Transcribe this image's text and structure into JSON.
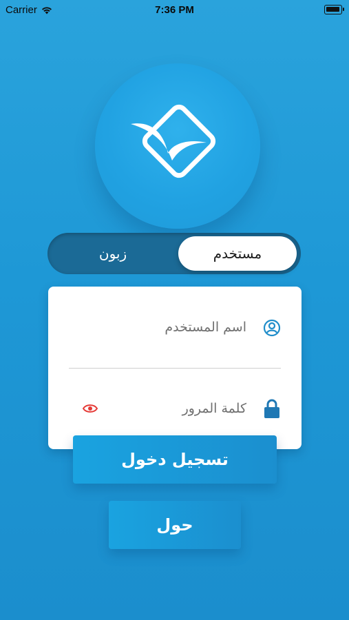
{
  "status_bar": {
    "carrier": "Carrier",
    "time": "7:36 PM"
  },
  "logo": {
    "icon": "app-logo-diamond-bird"
  },
  "user_type_toggle": {
    "active_label": "مستخدم",
    "inactive_label": "زبون"
  },
  "login_form": {
    "username_placeholder": "اسم المستخدم",
    "password_placeholder": "كلمة المرور",
    "user_icon": "user-circle-icon",
    "lock_icon": "lock-icon",
    "eye_icon": "eye-icon",
    "eye_color": "#e53935",
    "accent_color": "#1f8dca"
  },
  "buttons": {
    "login_label": "تسجيل دخول",
    "about_label": "حول"
  }
}
